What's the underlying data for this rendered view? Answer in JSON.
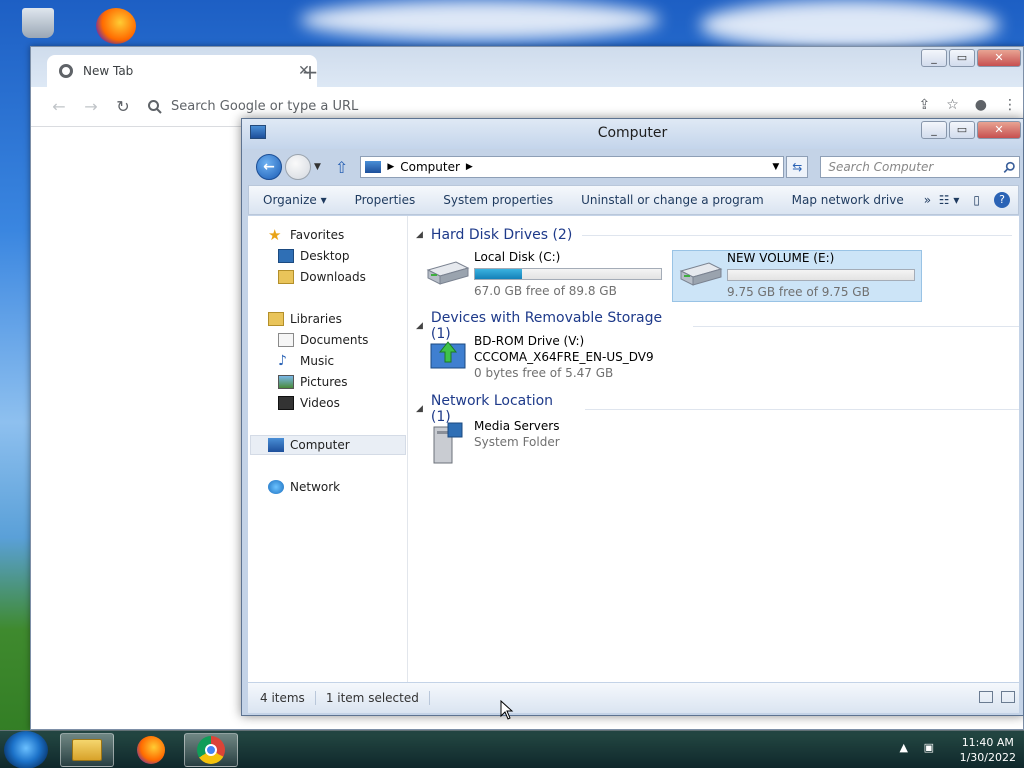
{
  "chrome": {
    "tab_title": "New Tab",
    "tab_close": "✕",
    "new_tab": "+",
    "omnibox_placeholder": "Search Google or type a URL"
  },
  "explorer": {
    "title": "Computer",
    "breadcrumb": "Computer",
    "search_placeholder": "Search Computer",
    "commands": [
      "Organize",
      "Properties",
      "System properties",
      "Uninstall or change a program",
      "Map network drive"
    ],
    "more": "»",
    "nav": {
      "favorites": "Favorites",
      "desktop": "Desktop",
      "downloads": "Downloads",
      "libraries": "Libraries",
      "documents": "Documents",
      "music": "Music",
      "pictures": "Pictures",
      "videos": "Videos",
      "computer": "Computer",
      "network": "Network"
    },
    "groups": {
      "hdd": "Hard Disk Drives (2)",
      "removable": "Devices with Removable Storage (1)",
      "network": "Network Location (1)"
    },
    "drives": {
      "c": {
        "name": "Local Disk (C:)",
        "free": "67.0 GB free of 89.8 GB",
        "used_fraction": 0.254
      },
      "e": {
        "name": "NEW VOLUME (E:)",
        "free": "9.75 GB free of 9.75 GB",
        "used_fraction": 0.0
      },
      "v": {
        "name": "BD-ROM Drive (V:)",
        "label": "CCCOMA_X64FRE_EN-US_DV9",
        "free": "0 bytes free of 5.47 GB"
      },
      "media": {
        "name": "Media Servers",
        "type": "System Folder"
      }
    },
    "status": {
      "items": "4 items",
      "selected": "1 item selected"
    }
  },
  "taskbar": {
    "time": "11:40 AM",
    "date": "1/30/2022"
  },
  "colors": {
    "accent": "#1e3a8a",
    "selection": "#cce4f7",
    "disk_bar": "#1481b8"
  }
}
